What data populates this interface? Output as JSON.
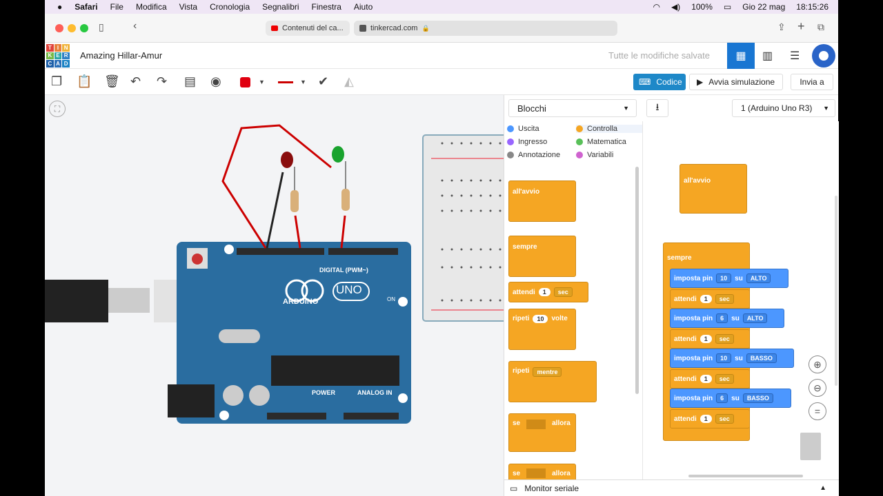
{
  "mac_menu": {
    "apple": "",
    "app": "Safari",
    "items": [
      "File",
      "Modifica",
      "Vista",
      "Cronologia",
      "Segnalibri",
      "Finestra",
      "Aiuto"
    ],
    "battery": "100%",
    "date": "Gio 22 mag",
    "time": "18:15:26"
  },
  "browser": {
    "tab1": "Contenuti del ca...",
    "tab2": "tinkercad.com"
  },
  "tinkercad": {
    "logo": [
      "T",
      "I",
      "N",
      "K",
      "E",
      "R",
      "C",
      "A",
      "D"
    ],
    "project_title": "Amazing Hillar-Amur",
    "saved_status": "Tutte le modifiche salvate"
  },
  "toolbar": {
    "code_button": "Codice",
    "simulate_button": "Avvia simulazione",
    "send_button": "Invia a"
  },
  "code": {
    "mode_select": "Blocchi",
    "device_select": "1 (Arduino Uno R3)",
    "categories": [
      {
        "label": "Uscita",
        "color": "#4c97ff"
      },
      {
        "label": "Controlla",
        "color": "#f5a623"
      },
      {
        "label": "Ingresso",
        "color": "#9966ff"
      },
      {
        "label": "Matematica",
        "color": "#59c059"
      },
      {
        "label": "Annotazione",
        "color": "#888888"
      },
      {
        "label": "Variabili",
        "color": "#cf63cf"
      }
    ],
    "palette": {
      "on_start": "all'avvio",
      "forever": "sempre",
      "wait": "attendi",
      "wait_val": "1",
      "sec": "sec",
      "repeat": "ripeti",
      "repeat_val": "10",
      "times": "volte",
      "repeat_while": "ripeti",
      "while": "mentre",
      "if": "se",
      "then": "allora",
      "if2": "se",
      "then2": "allora"
    },
    "workspace": {
      "on_start": "all'avvio",
      "forever": "sempre",
      "set_pin": "imposta pin",
      "on": "su",
      "wait": "attendi",
      "sec": "sec",
      "steps": [
        {
          "pin": "10",
          "state": "ALTO",
          "wait": "1"
        },
        {
          "pin": "6",
          "state": "ALTO",
          "wait": "1"
        },
        {
          "pin": "10",
          "state": "BASSO",
          "wait": "1"
        },
        {
          "pin": "6",
          "state": "BASSO",
          "wait": "1"
        }
      ]
    },
    "serial_monitor": "Monitor seriale"
  },
  "arduino": {
    "brand": "ARDUINO",
    "model": "UNO",
    "digital": "DIGITAL (PWM~)",
    "power": "POWER",
    "analog": "ANALOG IN",
    "on": "ON"
  }
}
